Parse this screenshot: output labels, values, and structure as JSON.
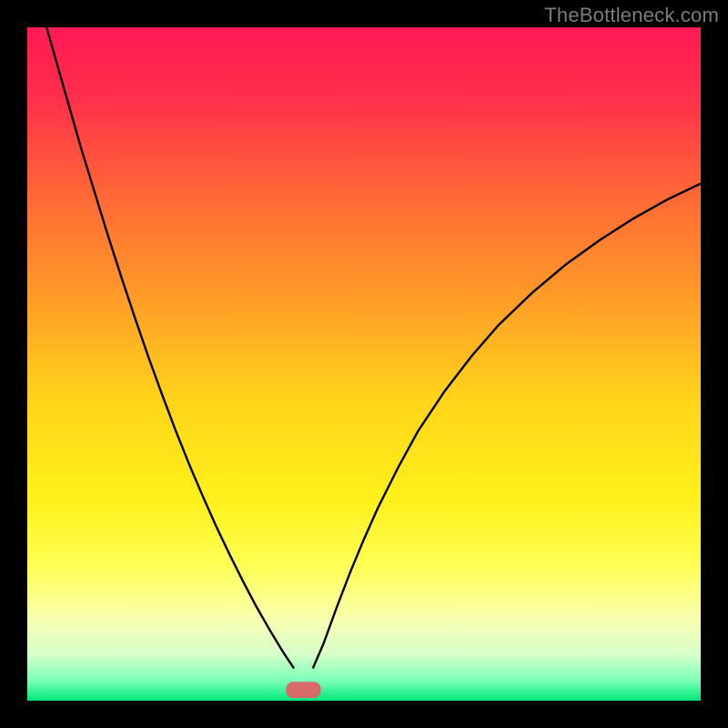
{
  "watermark": "TheBottleneck.com",
  "chart_data": {
    "type": "line",
    "title": "",
    "xlabel": "",
    "ylabel": "",
    "xlim": [
      0,
      100
    ],
    "ylim": [
      0,
      100
    ],
    "grid": false,
    "legend": false,
    "background_gradient_stops": [
      {
        "offset": 0.0,
        "color": "#ff1a55"
      },
      {
        "offset": 0.1,
        "color": "#ff2e4b"
      },
      {
        "offset": 0.25,
        "color": "#ff6836"
      },
      {
        "offset": 0.4,
        "color": "#ff9b28"
      },
      {
        "offset": 0.55,
        "color": "#ffd31a"
      },
      {
        "offset": 0.7,
        "color": "#fff01a"
      },
      {
        "offset": 0.8,
        "color": "#ffff55"
      },
      {
        "offset": 0.88,
        "color": "#f7ffb0"
      },
      {
        "offset": 0.93,
        "color": "#d8ffca"
      },
      {
        "offset": 0.97,
        "color": "#7bffb8"
      },
      {
        "offset": 1.0,
        "color": "#00e87a"
      }
    ],
    "series": [
      {
        "name": "left-branch",
        "x": [
          0,
          2,
          4,
          6,
          8,
          10,
          12,
          14,
          16,
          18,
          20,
          22,
          24,
          26,
          28,
          30,
          32,
          34,
          36,
          38,
          39.6
        ],
        "y": [
          110,
          103,
          96,
          89,
          82,
          75.5,
          69,
          62.8,
          56.8,
          51,
          45.5,
          40.2,
          35.2,
          30.5,
          26,
          21.8,
          17.8,
          14,
          10.5,
          7.2,
          4.8
        ]
      },
      {
        "name": "right-branch",
        "x": [
          42.4,
          44,
          46,
          48,
          50,
          52,
          55,
          58,
          62,
          66,
          70,
          75,
          80,
          85,
          90,
          95,
          100
        ],
        "y": [
          4.8,
          8.5,
          14,
          19.2,
          24,
          28.5,
          34.5,
          40,
          46,
          51.2,
          55.8,
          60.6,
          64.8,
          68.4,
          71.6,
          74.4,
          76.8
        ]
      }
    ],
    "marker": {
      "name": "minimum-pill",
      "x_center": 41,
      "y_center": 1.6,
      "width": 5.2,
      "height": 2.4,
      "color": "#d86a6a"
    }
  }
}
